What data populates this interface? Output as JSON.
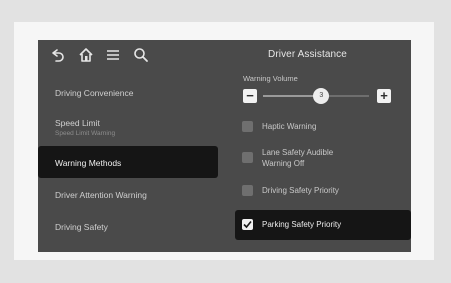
{
  "header": {
    "title": "Driver Assistance",
    "icons": [
      "back-icon",
      "home-icon",
      "menu-icon",
      "search-icon"
    ]
  },
  "sidebar": {
    "items": [
      {
        "label": "Driving Convenience",
        "sub": ""
      },
      {
        "label": "Speed Limit",
        "sub": "Speed Limit Warning"
      },
      {
        "label": "Warning Methods",
        "sub": ""
      },
      {
        "label": "Driver Attention Warning",
        "sub": ""
      },
      {
        "label": "Driving Safety",
        "sub": ""
      }
    ],
    "selected_index": 2
  },
  "warning_volume": {
    "label": "Warning Volume",
    "value": "3",
    "level_fraction": 0.55
  },
  "options": [
    {
      "label": "Haptic Warning",
      "checked": false
    },
    {
      "label": "Lane Safety Audible Warning Off",
      "checked": false
    },
    {
      "label": "Driving Safety Priority",
      "checked": false
    },
    {
      "label": "Parking Safety Priority",
      "checked": true
    }
  ],
  "colors": {
    "screen_bg": "#4a4a4a",
    "selected_bg": "#151515",
    "text": "#cfcfcf"
  }
}
